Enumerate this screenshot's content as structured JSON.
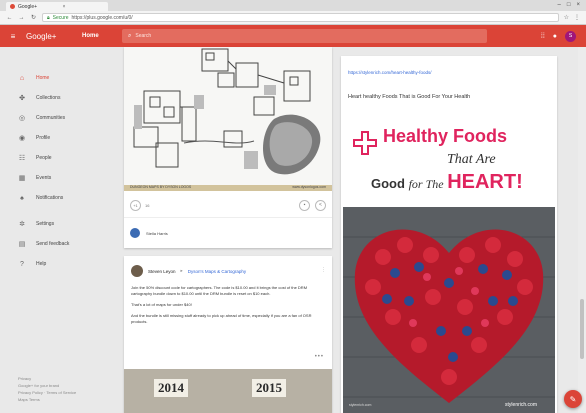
{
  "browser": {
    "tab_title": "Google+",
    "tab_close": "×",
    "secure_label": "Secure",
    "url": "https://plus.google.com/u/0/",
    "lock_icon": "lock-icon"
  },
  "appbar": {
    "brand": "Google+",
    "page": "Home",
    "search_placeholder": "Search",
    "avatar_letter": "S",
    "color": "#db4437"
  },
  "sidebar": {
    "items": [
      {
        "label": "Home",
        "icon": "⌂"
      },
      {
        "label": "Collections",
        "icon": "✤"
      },
      {
        "label": "Communities",
        "icon": "◎"
      },
      {
        "label": "Profile",
        "icon": "◉"
      },
      {
        "label": "People",
        "icon": "☷"
      },
      {
        "label": "Events",
        "icon": "▦"
      },
      {
        "label": "Notifications",
        "icon": "♠"
      },
      {
        "label": "Settings",
        "icon": "✲"
      },
      {
        "label": "Send feedback",
        "icon": "▤"
      },
      {
        "label": "Help",
        "icon": "?"
      }
    ],
    "footer": [
      "Privacy",
      "Google+ for your brand",
      "Privacy Policy · Terms of Service",
      "Maps Terms"
    ]
  },
  "card1": {
    "caption_left": "DUNGEON MAPS BY DYSON LOGOS",
    "caption_right": "www.dysonlogos.com",
    "plus_one": "+1",
    "count": "16",
    "commenter": "Stella Harris"
  },
  "card2": {
    "author": "Steven Leyon",
    "arrow": "▸",
    "community": "Dyson's Maps & Cartography",
    "more": "⋮",
    "paragraphs": [
      "Join the 50% discount code for cartographers. The code is $10.00 and it brings the cost of the DRM cartography bundle down to $10.00 until the DRM bundle is reset on $10 each.",
      "That's a lot of maps for under $40!",
      "And the bundle is still missing stuff already to pick up ahead of time, especially if you are a fan of OSR products."
    ],
    "dots": "•••",
    "years": [
      "2014",
      "2015"
    ]
  },
  "card3": {
    "link": "https://stylenrich.com/heart-healthy-foods/",
    "title": "Heart healthy Foods That is Good For Your Health",
    "image_text": {
      "line1": "Healthy Foods",
      "line2": "That Are",
      "line3a": "Good",
      "line3b": "for The",
      "line3c": "HEART!",
      "site": "stylenrich.com",
      "site_small": "stylenrich.com"
    }
  },
  "fab_icon": "✎"
}
